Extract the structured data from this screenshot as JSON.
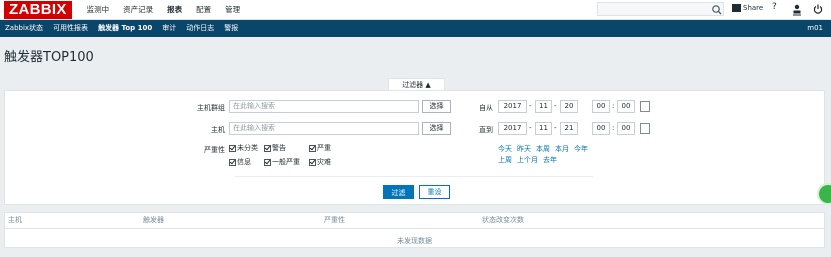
{
  "topbar": {
    "logo": "ZABBIX",
    "menu": [
      "监测中",
      "资产记录",
      "报表",
      "配置",
      "管理"
    ],
    "share_label": "Share",
    "help_label": "?",
    "user_label": "",
    "power_label": ""
  },
  "subnav": {
    "items": [
      "Zabbix状态",
      "可用性报表",
      "触发器 Top 100",
      "审计",
      "动作日志",
      "警报"
    ],
    "right_text": "m01"
  },
  "page": {
    "title": "触发器TOP100"
  },
  "filter": {
    "tab_label": "过滤器 ▲",
    "hostgroup_label": "主机群组",
    "hostgroup_placeholder": "在此输入搜索",
    "host_label": "主机",
    "host_placeholder": "在此输入搜索",
    "select_label": "选择",
    "severity_label": "严重性",
    "severities": [
      "未分类",
      "警告",
      "严重",
      "信息",
      "一般严重",
      "灾难"
    ],
    "from_label": "自从",
    "from": {
      "year": "2017",
      "month": "11",
      "day": "20",
      "hour": "00",
      "minute": "00"
    },
    "till_label": "直到",
    "till": {
      "year": "2017",
      "month": "11",
      "day": "21",
      "hour": "00",
      "minute": "00"
    },
    "quick_row1": [
      "今天",
      "昨天",
      "本周",
      "本月",
      "今年"
    ],
    "quick_row2": [
      "上周",
      "上个月",
      "去年"
    ],
    "apply_label": "过滤",
    "reset_label": "重设"
  },
  "table": {
    "columns": [
      "主机",
      "触发器",
      "严重性",
      "状态改变次数"
    ],
    "empty_text": "未发现数据"
  },
  "colors": {
    "brand": "#d40000",
    "subnav": "#0a466a",
    "primary": "#0275b8",
    "link": "#0275b8"
  }
}
